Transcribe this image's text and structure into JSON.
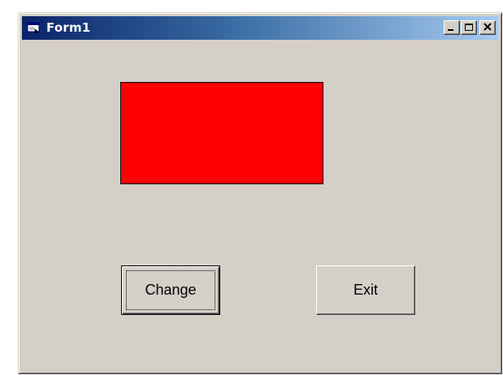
{
  "window": {
    "title": "Form1",
    "icon": "vb-form-icon",
    "caption_buttons": [
      "minimize-icon",
      "maximize-icon",
      "close-icon"
    ]
  },
  "form": {
    "shape_fill": "#ff0000",
    "buttons": {
      "change_label": "Change",
      "exit_label": "Exit"
    }
  },
  "colors": {
    "face": "#d4d0c8",
    "title_gradient_start": "#0a246a",
    "title_gradient_end": "#a6caf0"
  }
}
